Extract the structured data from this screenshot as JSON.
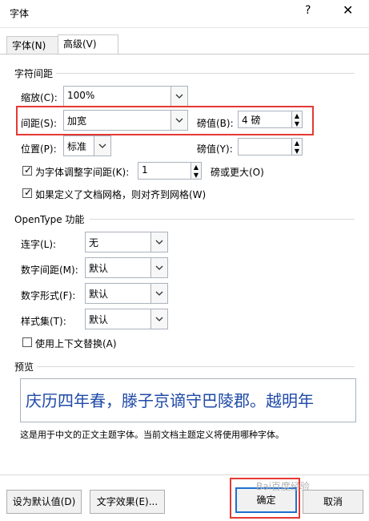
{
  "window": {
    "title": "字体",
    "help": "?",
    "close": "✕"
  },
  "tabs": [
    {
      "label": "字体(N)"
    },
    {
      "label": "高级(V)"
    }
  ],
  "spacing": {
    "section": "字符间距",
    "scale_label": "缩放(C):",
    "scale_value": "100%",
    "spacing_label": "间距(S):",
    "spacing_value": "加宽",
    "spacing_points_label": "磅值(B):",
    "spacing_points_value": "4 磅",
    "position_label": "位置(P):",
    "position_value": "标准",
    "position_points_label": "磅值(Y):",
    "position_points_value": "",
    "kerning_label": "为字体调整字间距(K):",
    "kerning_value": "1",
    "kerning_unit": "磅或更大(O)",
    "grid_label": "如果定义了文档网格，则对齐到网格(W)"
  },
  "opentype": {
    "section": "OpenType 功能",
    "ligatures_label": "连字(L):",
    "ligatures_value": "无",
    "numspacing_label": "数字间距(M):",
    "numspacing_value": "默认",
    "numform_label": "数字形式(F):",
    "numform_value": "默认",
    "styleset_label": "样式集(T):",
    "styleset_value": "默认",
    "contextual_label": "使用上下文替换(A)"
  },
  "preview": {
    "section": "预览",
    "text": "庆历四年春，滕子京谪守巴陵郡。越明年",
    "description": "这是用于中文的正文主题字体。当前文档主题定义将使用哪种字体。"
  },
  "footer": {
    "set_default": "设为默认值(D)",
    "text_effects": "文字效果(E)...",
    "ok": "确定",
    "cancel": "取消",
    "watermark": "Bai百度经验"
  }
}
